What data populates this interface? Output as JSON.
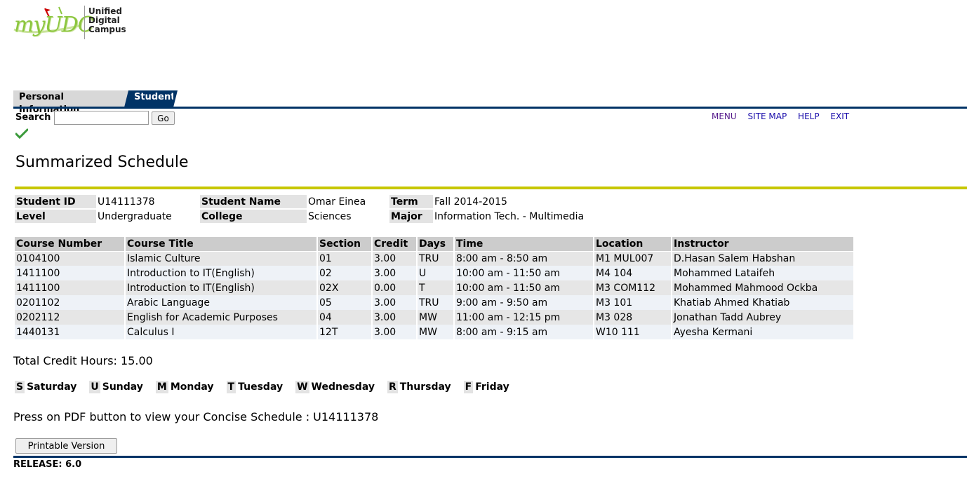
{
  "logo": {
    "word": "myUDC",
    "lines": [
      "Unified",
      "Digital",
      "Campus"
    ],
    "accent_color": "#8cc63f"
  },
  "tabs": [
    {
      "label": "Personal Information",
      "active": false
    },
    {
      "label": "Student",
      "active": true
    }
  ],
  "search": {
    "label": "Search",
    "value": "",
    "placeholder": "",
    "go_label": "Go"
  },
  "top_links": [
    "MENU",
    "SITE MAP",
    "HELP",
    "EXIT"
  ],
  "page_title": "Summarized Schedule",
  "student": {
    "id_label": "Student ID",
    "id": "U14111378",
    "name_label": "Student Name",
    "name": "Omar Einea",
    "term_label": "Term",
    "term": "Fall 2014-2015",
    "level_label": "Level",
    "level": "Undergraduate",
    "college_label": "College",
    "college": "Sciences",
    "major_label": "Major",
    "major": "Information Tech. - Multimedia"
  },
  "schedule": {
    "headers": [
      "Course Number",
      "Course Title",
      "Section",
      "Credit",
      "Days",
      "Time",
      "Location",
      "Instructor"
    ],
    "rows": [
      [
        "0104100",
        "Islamic Culture",
        "01",
        "3.00",
        "TRU",
        "8:00 am - 8:50 am",
        "M1 MUL007",
        "D.Hasan Salem Habshan"
      ],
      [
        "1411100",
        "Introduction to IT(English)",
        "02",
        "3.00",
        "U",
        "10:00 am - 11:50 am",
        "M4 104",
        "Mohammed Lataifeh"
      ],
      [
        "1411100",
        "Introduction to IT(English)",
        "02X",
        "0.00",
        "T",
        "10:00 am - 11:50 am",
        "M3 COM112",
        "Mohammed Mahmood Ockba"
      ],
      [
        "0201102",
        "Arabic Language",
        "05",
        "3.00",
        "TRU",
        "9:00 am - 9:50 am",
        "M3 101",
        "Khatiab Ahmed Khatiab"
      ],
      [
        "0202112",
        "English for Academic Purposes",
        "04",
        "3.00",
        "MW",
        "11:00 am - 12:15 pm",
        "M3 028",
        "Jonathan Tadd Aubrey"
      ],
      [
        "1440131",
        "Calculus I",
        "12T",
        "3.00",
        "MW",
        "8:00 am - 9:15 am",
        "W10 111",
        "Ayesha Kermani"
      ]
    ]
  },
  "total_credit": "Total Credit Hours: 15.00",
  "days_legend": [
    {
      "code": "S",
      "name": "Saturday"
    },
    {
      "code": "U",
      "name": "Sunday"
    },
    {
      "code": "M",
      "name": "Monday"
    },
    {
      "code": "T",
      "name": "Tuesday"
    },
    {
      "code": "W",
      "name": "Wednesday"
    },
    {
      "code": "R",
      "name": "Thursday"
    },
    {
      "code": "F",
      "name": "Friday"
    }
  ],
  "pdf_note": "Press on PDF button to view your Concise Schedule : U14111378",
  "print_button": "Printable Version",
  "release": "RELEASE: 6.0",
  "icons": {
    "check": "check-icon"
  },
  "colors": {
    "nav": "#003366",
    "title_rule": "#c7c700",
    "link": "#1a0dab"
  }
}
